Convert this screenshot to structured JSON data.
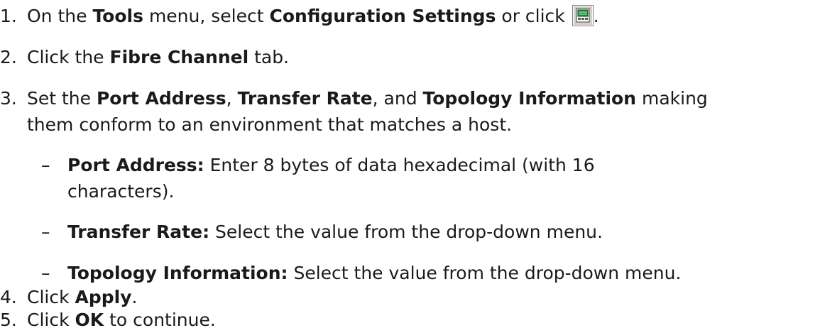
{
  "steps": [
    {
      "num": "1.",
      "parts": [
        "On the ",
        "Tools",
        " menu, select ",
        "Configuration Settings",
        " or click ",
        "."
      ]
    },
    {
      "num": "2.",
      "parts": [
        "Click the ",
        "Fibre Channel",
        " tab."
      ]
    },
    {
      "num": "3.",
      "parts": [
        "Set the ",
        "Port Address",
        ", ",
        "Transfer Rate",
        ", and ",
        "Topology Information",
        " making",
        "them conform to an environment that matches a host."
      ]
    },
    {
      "num": "4.",
      "parts": [
        "Click ",
        "Apply",
        "."
      ]
    },
    {
      "num": "5.",
      "parts": [
        "Click ",
        "OK",
        " to continue."
      ]
    }
  ],
  "substeps": [
    {
      "dash": "–",
      "label": "Port Address:",
      "text": " Enter 8 bytes of data hexadecimal (with 16",
      "text2": "characters)."
    },
    {
      "dash": "–",
      "label": "Transfer Rate:",
      "text": " Select the value from the drop-down menu."
    },
    {
      "dash": "–",
      "label": "Topology Information:",
      "text": " Select the value from the drop-down menu."
    }
  ],
  "icon": {
    "name": "configuration-settings-icon",
    "colors": {
      "frame": "#808080",
      "screen": "#1f8f3a",
      "light": "#ffffff"
    }
  }
}
